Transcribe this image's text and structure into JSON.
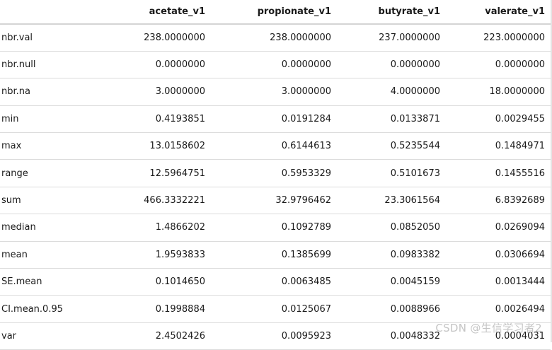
{
  "table": {
    "columns": [
      "",
      "acetate_v1",
      "propionate_v1",
      "butyrate_v1",
      "valerate_v1"
    ],
    "rows": [
      [
        "nbr.val",
        "238.0000000",
        "238.0000000",
        "237.0000000",
        "223.0000000"
      ],
      [
        "nbr.null",
        "0.0000000",
        "0.0000000",
        "0.0000000",
        "0.0000000"
      ],
      [
        "nbr.na",
        "3.0000000",
        "3.0000000",
        "4.0000000",
        "18.0000000"
      ],
      [
        "min",
        "0.4193851",
        "0.0191284",
        "0.0133871",
        "0.0029455"
      ],
      [
        "max",
        "13.0158602",
        "0.6144613",
        "0.5235544",
        "0.1484971"
      ],
      [
        "range",
        "12.5964751",
        "0.5953329",
        "0.5101673",
        "0.1455516"
      ],
      [
        "sum",
        "466.3332221",
        "32.9796462",
        "23.3061564",
        "6.8392689"
      ],
      [
        "median",
        "1.4866202",
        "0.1092789",
        "0.0852050",
        "0.0269094"
      ],
      [
        "mean",
        "1.9593833",
        "0.1385699",
        "0.0983382",
        "0.0306694"
      ],
      [
        "SE.mean",
        "0.1014650",
        "0.0063485",
        "0.0045159",
        "0.0013444"
      ],
      [
        "CI.mean.0.95",
        "0.1998884",
        "0.0125067",
        "0.0088966",
        "0.0026494"
      ],
      [
        "var",
        "2.4502426",
        "0.0095923",
        "0.0048332",
        "0.0004031"
      ]
    ]
  },
  "watermark": "CSDN @生信学习者2"
}
